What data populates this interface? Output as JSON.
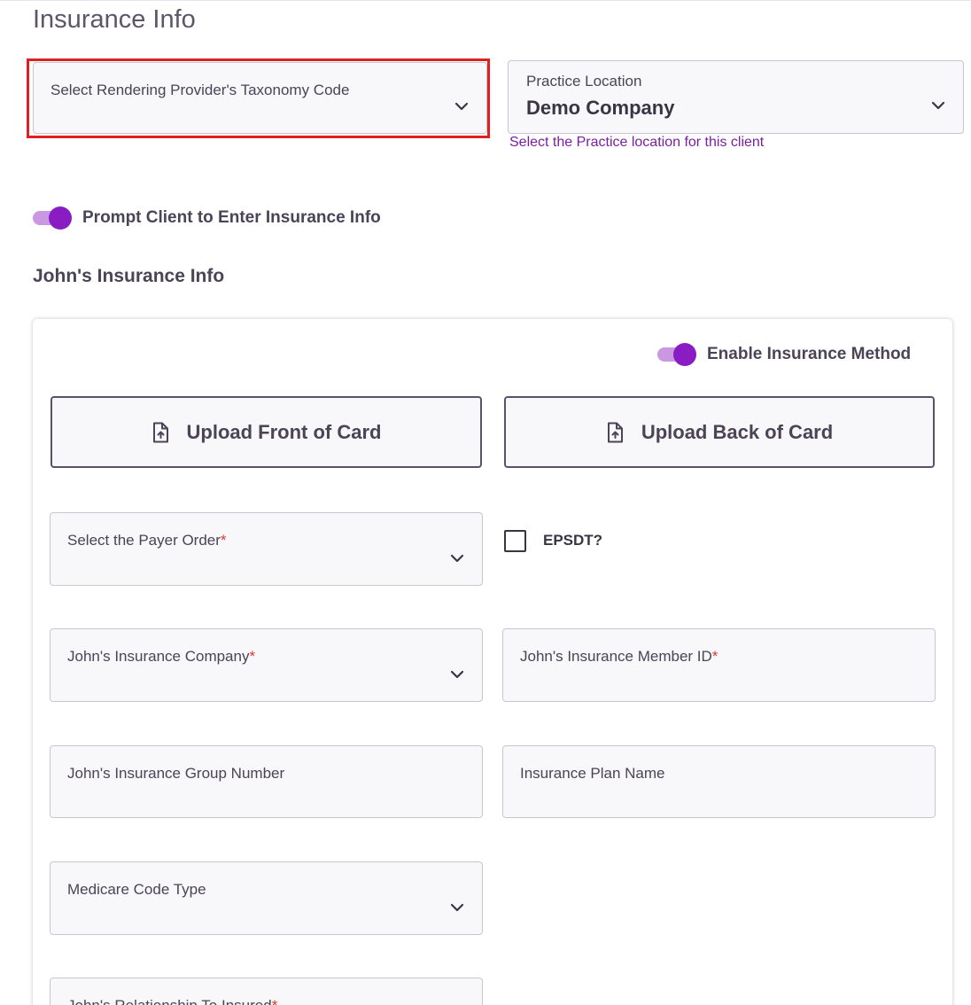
{
  "page": {
    "title": "Insurance Info"
  },
  "taxonomy": {
    "label": "Select Rendering Provider's Taxonomy Code",
    "value": ""
  },
  "practice_location": {
    "label": "Practice Location",
    "value": "Demo Company",
    "helper": "Select the Practice location for this client"
  },
  "prompt_toggle": {
    "label": "Prompt Client to Enter Insurance Info",
    "on": true
  },
  "section": {
    "title": "John's Insurance Info"
  },
  "enable_method": {
    "label": "Enable Insurance Method",
    "on": true
  },
  "upload": {
    "front_label": "Upload Front of Card",
    "back_label": "Upload Back of Card"
  },
  "payer_order": {
    "label": "Select the Payer Order",
    "required": "*"
  },
  "epsdt": {
    "label": "EPSDT?",
    "checked": false
  },
  "insurance_company": {
    "label": "John's Insurance Company",
    "required": "*"
  },
  "member_id": {
    "label": "John's Insurance Member ID",
    "required": "*"
  },
  "group_number": {
    "label": "John's Insurance Group Number"
  },
  "plan_name": {
    "label": "Insurance Plan Name"
  },
  "medicare_code": {
    "label": "Medicare Code Type"
  },
  "relationship": {
    "label": "John's Relationship To Insured",
    "required": "*"
  },
  "colors": {
    "accent": "#8a1cc4",
    "accent_light": "#c998e0",
    "helper_text": "#7a1fa2",
    "required": "#d93a2b",
    "highlight": "#e02020"
  }
}
